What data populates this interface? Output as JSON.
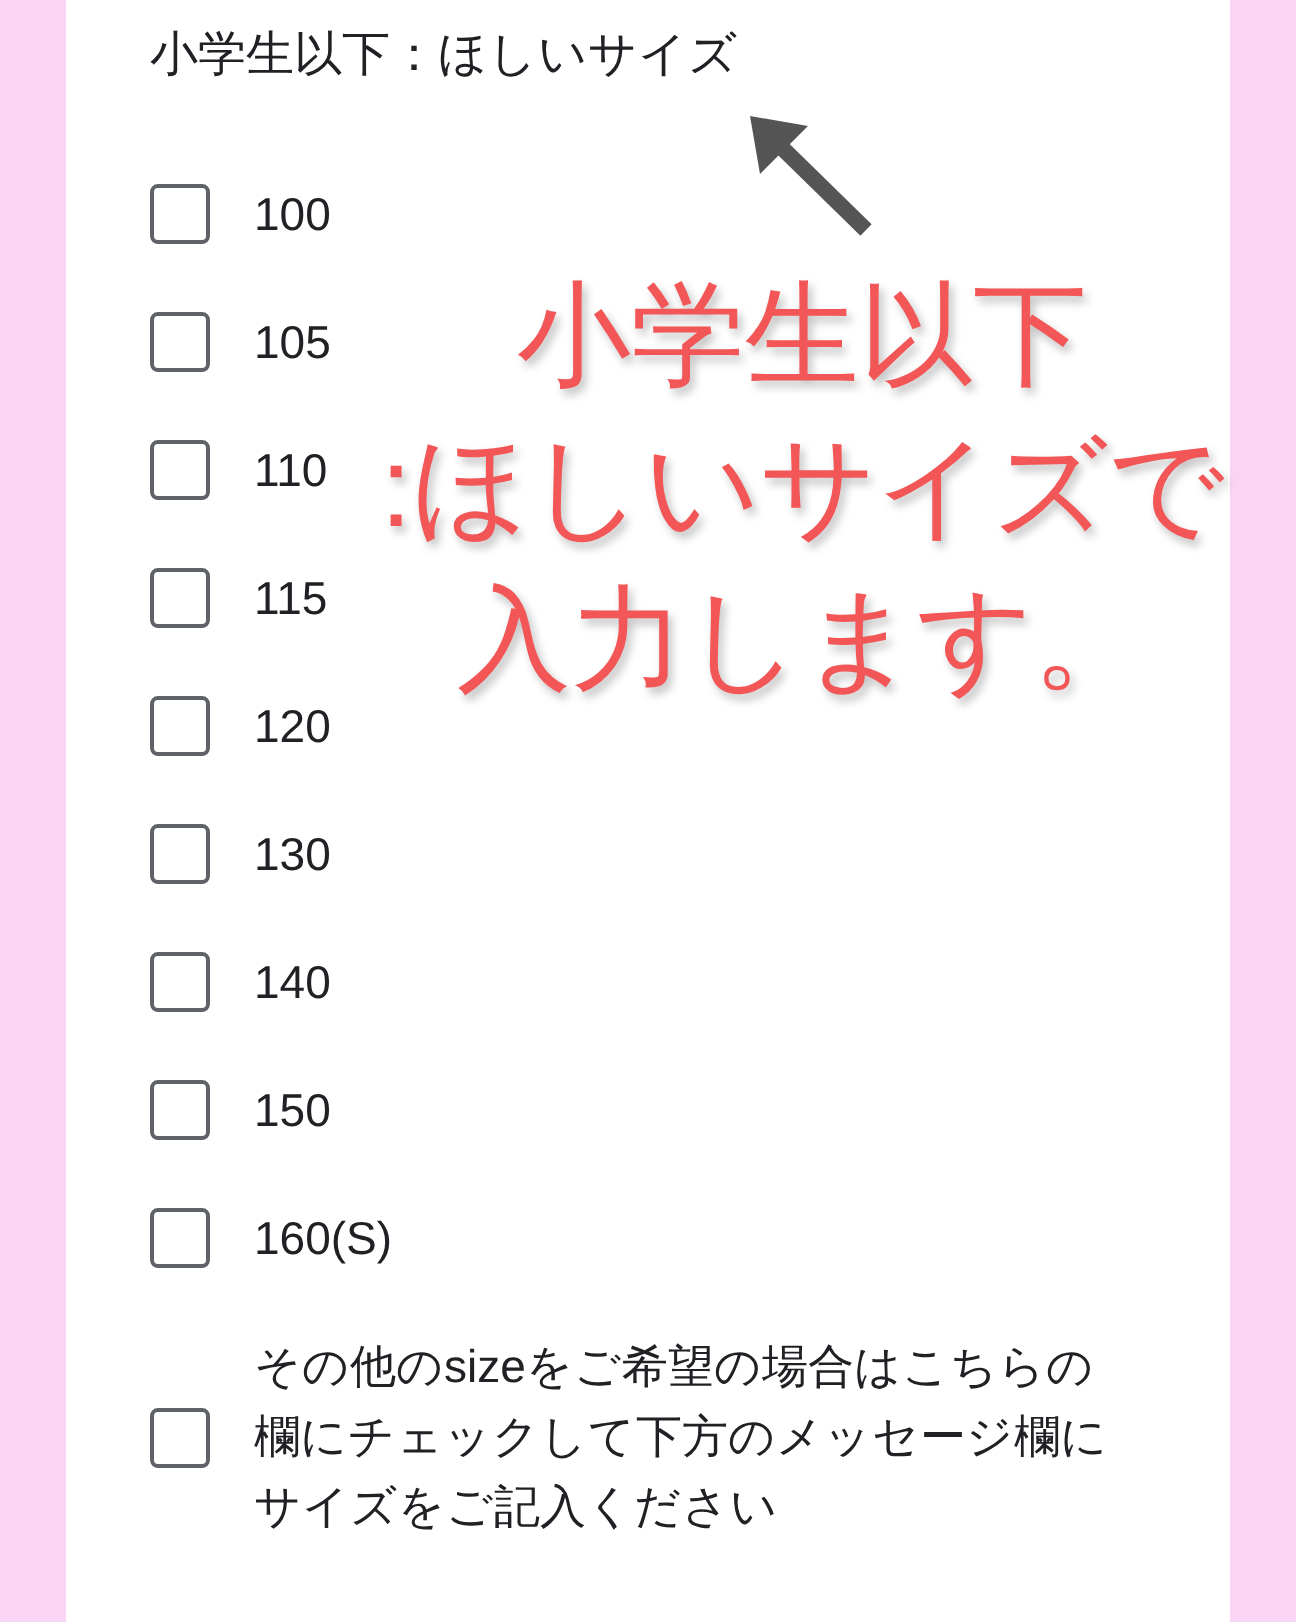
{
  "question": {
    "title": "小学生以下：ほしいサイズ"
  },
  "options": [
    {
      "label": "100",
      "checked": false
    },
    {
      "label": "105",
      "checked": false
    },
    {
      "label": "110",
      "checked": false
    },
    {
      "label": "115",
      "checked": false
    },
    {
      "label": "120",
      "checked": false
    },
    {
      "label": "130",
      "checked": false
    },
    {
      "label": "140",
      "checked": false
    },
    {
      "label": "150",
      "checked": false
    },
    {
      "label": "160(S)",
      "checked": false
    },
    {
      "label": "その他のsizeをご希望の場合はこちらの欄にチェックして下方のメッセージ欄にサイズをご記入ください",
      "checked": false
    }
  ],
  "annotation": {
    "lines": [
      "小学生以下",
      ":ほしいサイズで",
      "入力します。"
    ]
  }
}
